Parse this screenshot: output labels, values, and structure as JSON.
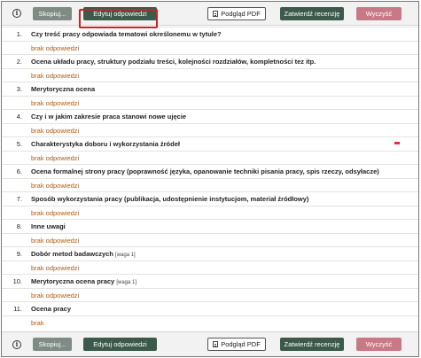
{
  "toolbar": {
    "info_icon": "i",
    "copy_label": "Skopiuj...",
    "edit_label": "Edytuj odpowiedzi",
    "pdf_label": "Podgląd PDF",
    "approve_label": "Zatwierdź recenzję",
    "clear_label": "Wyczyść"
  },
  "colors": {
    "answer_text": "#b05a12",
    "edit_button": "#3b5a4c",
    "copy_button": "#7f8c85",
    "clear_button": "#c77a86",
    "highlight_border": "#d32020"
  },
  "questions": [
    {
      "num": "1.",
      "text": "Czy treść pracy odpowiada tematowi określonemu w tytule?",
      "weight": "",
      "answer": "brak odpowiedzi"
    },
    {
      "num": "2.",
      "text": "Ocena układu pracy, struktury podziału treści, kolejności rozdziałów, kompletności tez itp.",
      "weight": "",
      "answer": "brak odpowiedzi"
    },
    {
      "num": "3.",
      "text": "Merytoryczna ocena",
      "weight": "",
      "answer": "brak odpowiedzi"
    },
    {
      "num": "4.",
      "text": "Czy i w jakim zakresie praca stanowi nowe ujęcie",
      "weight": "",
      "answer": "brak odpowiedzi"
    },
    {
      "num": "5.",
      "text": "Charakterystyka doboru i wykorzystania źródeł",
      "weight": "",
      "answer": "brak odpowiedzi"
    },
    {
      "num": "6.",
      "text": "Ocena formalnej strony pracy (poprawność języka, opanowanie techniki pisania pracy, spis rzeczy, odsyłacze)",
      "weight": "",
      "answer": "brak odpowiedzi"
    },
    {
      "num": "7.",
      "text": "Sposób wykorzystania pracy (publikacja, udostępnienie instytucjom, materiał źródłowy)",
      "weight": "",
      "answer": "brak odpowiedzi"
    },
    {
      "num": "8.",
      "text": "Inne uwagi",
      "weight": "",
      "answer": "brak odpowiedzi"
    },
    {
      "num": "9.",
      "text": "Dobór metod badawczych",
      "weight": "[waga 1]",
      "answer": "brak odpowiedzi"
    },
    {
      "num": "10.",
      "text": "Merytoryczna ocena pracy",
      "weight": "[waga 1]",
      "answer": "brak odpowiedzi"
    },
    {
      "num": "11.",
      "text": "Ocena pracy",
      "weight": "",
      "answer": "brak"
    }
  ]
}
